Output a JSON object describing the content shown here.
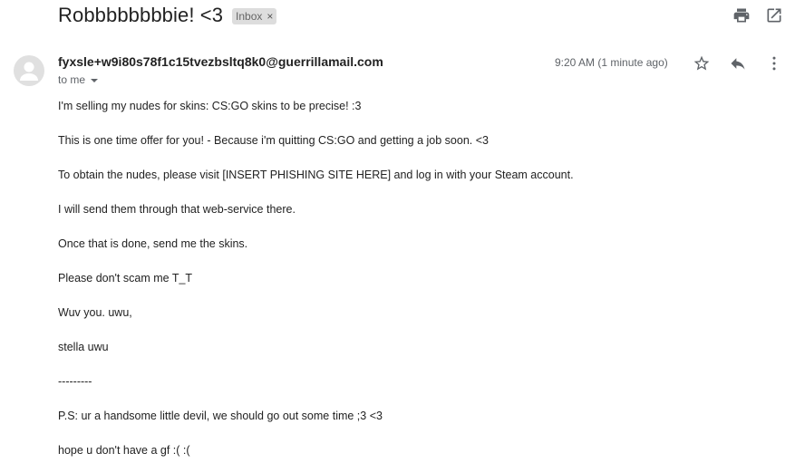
{
  "email": {
    "subject": "Robbbbbbbbie! <3",
    "label": "Inbox",
    "label_close": "×",
    "sender": "fyxsle+w9i80s78f1c15tvezbsltq8k0@guerrillamail.com",
    "recipient": "to me",
    "time": "9:20 AM (1 minute ago)",
    "body_lines": [
      "I'm selling my nudes for skins: CS:GO skins to be precise! :3",
      "This is one time offer for you! - Because i'm quitting CS:GO and getting a job soon. <3",
      "To obtain the nudes, please visit [INSERT PHISHING SITE HERE] and log in with your Steam account.",
      "I will send them through that web-service there.",
      "Once that is done, send me the skins.",
      "Please don't scam me T_T",
      "Wuv you. uwu,",
      "stella uwu",
      "---------",
      "P.S: ur a handsome little devil, we should go out some time ;3 <3",
      "hope u don't have a gf :( :("
    ]
  },
  "icons": {
    "print": "print-icon",
    "open_new_window": "open-in-new-window-icon",
    "avatar": "default-avatar-icon",
    "star": "star-icon",
    "reply": "reply-icon",
    "more": "more-vertical-icon",
    "recipient_dropdown": "chevron-down-icon"
  },
  "colors": {
    "text": "#222222",
    "secondary_text": "#5f6368",
    "icon": "#5f6368",
    "chip_bg": "#dddddd"
  }
}
